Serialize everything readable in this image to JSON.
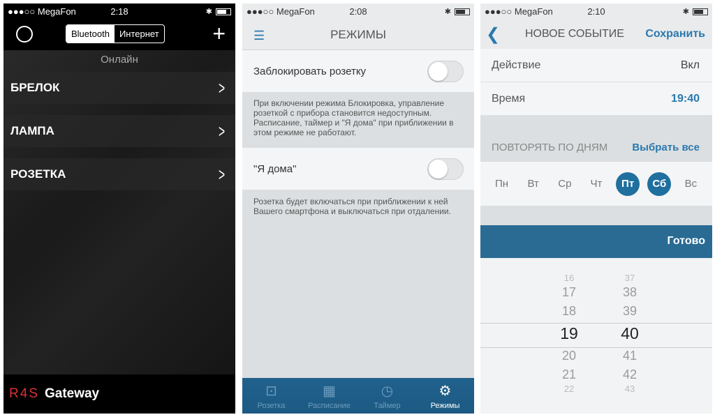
{
  "screen1": {
    "status": {
      "carrier": "●●●○○ MegaFon",
      "time": "2:18"
    },
    "segments": [
      "Bluetooth",
      "Интернет"
    ],
    "active_segment": "Bluetooth",
    "plus": "+",
    "online": "Онлайн",
    "devices": [
      "БРЕЛОК",
      "ЛАМПА",
      "РОЗЕТКА"
    ],
    "logo": "R4S",
    "app_name": "Gateway"
  },
  "screen2": {
    "status": {
      "carrier": "●●●○○ MegaFon",
      "time": "2:08"
    },
    "title": "РЕЖИМЫ",
    "modes": [
      {
        "label": "Заблокировать розетку",
        "on": false,
        "description": "При включении режима Блокировка, управление розеткой с прибора становится недоступным. Расписание, таймер и \"Я дома\" при приближении в этом режиме не работают."
      },
      {
        "label": "\"Я дома\"",
        "on": false,
        "description": "Розетка будет включаться при приближении к ней Вашего смартфона и выключаться при отдалении."
      }
    ],
    "tabs": [
      {
        "label": "Розетка",
        "icon": "socket-icon"
      },
      {
        "label": "Расписание",
        "icon": "calendar-icon"
      },
      {
        "label": "Таймер",
        "icon": "timer-24-icon"
      },
      {
        "label": "Режимы",
        "icon": "gear-icon"
      }
    ],
    "active_tab": "Режимы"
  },
  "screen3": {
    "status": {
      "carrier": "●●●○○ MegaFon",
      "time": "2:10"
    },
    "title": "НОВОЕ СОБЫТИЕ",
    "save": "Сохранить",
    "action_label": "Действие",
    "action_value": "Вкл",
    "time_label": "Время",
    "time_value": "19:40",
    "repeat_label": "ПОВТОРЯТЬ ПО ДНЯМ",
    "select_all": "Выбрать все",
    "days": [
      {
        "label": "Пн",
        "on": false
      },
      {
        "label": "Вт",
        "on": false
      },
      {
        "label": "Ср",
        "on": false
      },
      {
        "label": "Чт",
        "on": false
      },
      {
        "label": "Пт",
        "on": true
      },
      {
        "label": "Сб",
        "on": true
      },
      {
        "label": "Вс",
        "on": false
      }
    ],
    "done": "Готово",
    "hours": [
      "16",
      "17",
      "18",
      "19",
      "20",
      "21",
      "22"
    ],
    "minutes": [
      "37",
      "38",
      "39",
      "40",
      "41",
      "42",
      "43"
    ],
    "selected_hour": "19",
    "selected_minute": "40"
  },
  "colors": {
    "accent": "#2a79ae",
    "tabbar": "#1f5f88",
    "done_bar": "#2a6b94",
    "logo_red": "#d8303a"
  }
}
